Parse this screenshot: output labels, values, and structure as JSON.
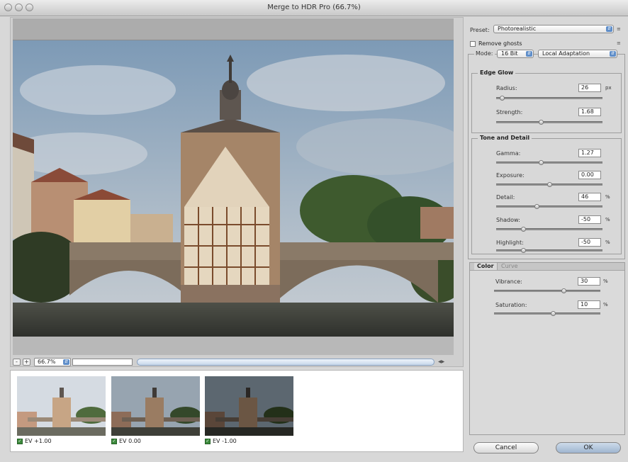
{
  "window": {
    "title": "Merge to HDR Pro (66.7%)"
  },
  "preview": {
    "zoom_value": "66.7%",
    "zoom_minus": "-",
    "zoom_plus": "+"
  },
  "filmstrip": [
    {
      "label": "EV +1.00",
      "checked": true
    },
    {
      "label": "EV 0.00",
      "checked": true
    },
    {
      "label": "EV -1.00",
      "checked": true
    }
  ],
  "panel": {
    "preset_label": "Preset:",
    "preset_value": "Photorealistic",
    "remove_ghosts": "Remove ghosts",
    "mode_label": "Mode:",
    "mode_bit": "16 Bit",
    "mode_method": "Local Adaptation",
    "edge_glow": {
      "title": "Edge Glow",
      "radius_label": "Radius:",
      "radius_value": "26",
      "radius_unit": "px",
      "radius_fraction": 0.05,
      "strength_label": "Strength:",
      "strength_value": "1.68",
      "strength_unit": "",
      "strength_fraction": 0.42
    },
    "tone_detail": {
      "title": "Tone and Detail",
      "gamma_label": "Gamma:",
      "gamma_value": "1.27",
      "gamma_fraction": 0.42,
      "exposure_label": "Exposure:",
      "exposure_value": "0.00",
      "exposure_fraction": 0.5,
      "detail_label": "Detail:",
      "detail_value": "46",
      "detail_unit": "%",
      "detail_fraction": 0.38,
      "shadow_label": "Shadow:",
      "shadow_value": "-50",
      "shadow_unit": "%",
      "shadow_fraction": 0.25,
      "highlight_label": "Highlight:",
      "highlight_value": "-50",
      "highlight_unit": "%",
      "highlight_fraction": 0.25
    },
    "tabs": [
      "Color",
      "Curve"
    ],
    "color": {
      "vibrance_label": "Vibrance:",
      "vibrance_value": "30",
      "vibrance_unit": "%",
      "vibrance_fraction": 0.65,
      "saturation_label": "Saturation:",
      "saturation_value": "10",
      "saturation_unit": "%",
      "saturation_fraction": 0.55
    },
    "cancel_label": "Cancel",
    "ok_label": "OK"
  },
  "colors": {
    "accent": "#5f8ec9",
    "ok_button": "#a9bfd9"
  }
}
